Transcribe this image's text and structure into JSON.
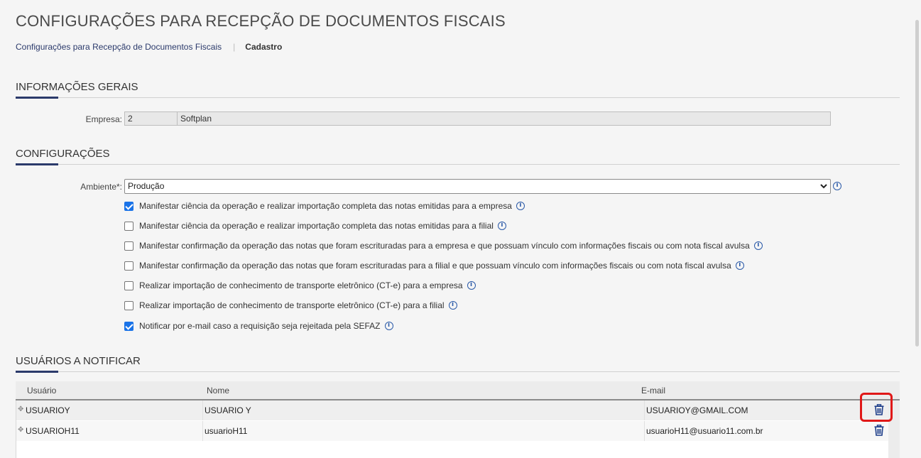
{
  "header": {
    "title": "CONFIGURAÇÕES PARA RECEPÇÃO DE DOCUMENTOS FISCAIS",
    "breadcrumb": {
      "link": "Configurações para Recepção de Documentos Fiscais",
      "current": "Cadastro"
    }
  },
  "general": {
    "section_title": "INFORMAÇÕES GERAIS",
    "empresa_label": "Empresa:",
    "empresa_code": "2",
    "empresa_name": "Softplan"
  },
  "config": {
    "section_title": "CONFIGURAÇÕES",
    "ambiente_label": "Ambiente*:",
    "ambiente_value": "Produção",
    "options": [
      {
        "label": "Manifestar ciência da operação e realizar importação completa das notas emitidas para a empresa",
        "checked": true
      },
      {
        "label": "Manifestar ciência da operação e realizar importação completa das notas emitidas para a filial",
        "checked": false
      },
      {
        "label": "Manifestar confirmação da operação das notas que foram escrituradas para a empresa e que possuam vínculo com informações fiscais ou com nota fiscal avulsa",
        "checked": false
      },
      {
        "label": "Manifestar confirmação da operação das notas que foram escrituradas para a filial e que possuam vínculo com informações fiscais ou com nota fiscal avulsa",
        "checked": false
      },
      {
        "label": "Realizar importação de conhecimento de transporte eletrônico (CT-e) para a empresa",
        "checked": false
      },
      {
        "label": "Realizar importação de conhecimento de transporte eletrônico (CT-e) para a filial",
        "checked": false
      },
      {
        "label": "Notificar por e-mail caso a requisição seja rejeitada pela SEFAZ",
        "checked": true
      }
    ]
  },
  "users": {
    "section_title": "USUÁRIOS A NOTIFICAR",
    "columns": {
      "usuario": "Usuário",
      "nome": "Nome",
      "email": "E-mail"
    },
    "rows": [
      {
        "usuario": "USUARIOY",
        "nome": "USUARIO Y",
        "email": "USUARIOY@GMAIL.COM"
      },
      {
        "usuario": "USUARIOH11",
        "nome": "usuarioH11",
        "email": "usuarioH11@usuario11.com.br"
      }
    ]
  },
  "colors": {
    "accent": "#2b3a6b",
    "checkbox": "#1a73e8",
    "info_icon": "#2b5aa8",
    "trash_icon": "#1f3f8a",
    "highlight": "#e01818"
  },
  "icons": [
    "info-icon",
    "trash-icon",
    "expander-icon",
    "chevron-down-icon"
  ]
}
